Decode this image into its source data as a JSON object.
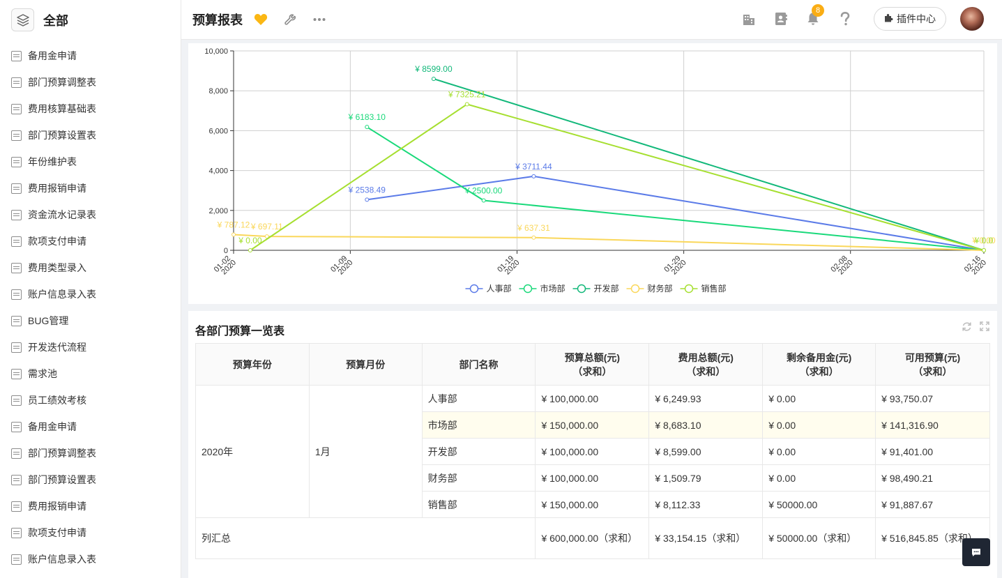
{
  "sidebar": {
    "title": "全部",
    "items": [
      {
        "label": "备用金申请"
      },
      {
        "label": "部门预算调整表"
      },
      {
        "label": "费用核算基础表"
      },
      {
        "label": "部门预算设置表"
      },
      {
        "label": "年份维护表"
      },
      {
        "label": "费用报销申请"
      },
      {
        "label": "资金流水记录表"
      },
      {
        "label": "款项支付申请"
      },
      {
        "label": "费用类型录入"
      },
      {
        "label": "账户信息录入表"
      },
      {
        "label": "BUG管理"
      },
      {
        "label": "开发迭代流程"
      },
      {
        "label": "需求池"
      },
      {
        "label": "员工绩效考核"
      },
      {
        "label": "备用金申请"
      },
      {
        "label": "部门预算调整表"
      },
      {
        "label": "部门预算设置表"
      },
      {
        "label": "费用报销申请"
      },
      {
        "label": "款项支付申请"
      },
      {
        "label": "账户信息录入表"
      }
    ]
  },
  "header": {
    "title": "预算报表",
    "notification_count": "8",
    "plugin_label": "插件中心",
    "icons": [
      "favorite-icon",
      "wrench-icon",
      "more-icon",
      "building-icon",
      "contacts-icon",
      "bell-icon",
      "help-icon",
      "puzzle-icon"
    ]
  },
  "chart_data": {
    "type": "line",
    "y_ticks": [
      "10,000",
      "8,000",
      "6,000",
      "4,000",
      "2,000",
      "0"
    ],
    "ylim": [
      0,
      10000
    ],
    "x_ticks": [
      {
        "date": "01-02",
        "year": "2020"
      },
      {
        "date": "01-09",
        "year": "2020"
      },
      {
        "date": "01-19",
        "year": "2020"
      },
      {
        "date": "01-29",
        "year": "2020"
      },
      {
        "date": "02-08",
        "year": "2020"
      },
      {
        "date": "02-16",
        "year": "2020"
      }
    ],
    "xlim": [
      "2020-01-02",
      "2020-02-16"
    ],
    "grid": true,
    "legend_position": "bottom-center",
    "series": [
      {
        "name": "人事部",
        "color": "#5b7be8",
        "points": [
          [
            "2020-01-10",
            2538.49
          ],
          [
            "2020-01-20",
            3711.44
          ],
          [
            "2020-02-16",
            0
          ]
        ],
        "labels": [
          "¥ 2538.49",
          "¥ 3711.44",
          ""
        ]
      },
      {
        "name": "市场部",
        "color": "#19d97a",
        "points": [
          [
            "2020-01-10",
            6183.1
          ],
          [
            "2020-01-17",
            2500.0
          ],
          [
            "2020-02-16",
            0
          ]
        ],
        "labels": [
          "¥ 6183.10",
          "¥ 2500.00",
          ""
        ]
      },
      {
        "name": "开发部",
        "color": "#12b87a",
        "points": [
          [
            "2020-01-14",
            8599.0
          ],
          [
            "2020-02-16",
            0
          ]
        ],
        "labels": [
          "¥ 8599.00",
          ""
        ]
      },
      {
        "name": "财务部",
        "color": "#fad75a",
        "points": [
          [
            "2020-01-02",
            787.12
          ],
          [
            "2020-01-04",
            697.11
          ],
          [
            "2020-01-20",
            637.31
          ],
          [
            "2020-02-16",
            0
          ]
        ],
        "labels": [
          "¥ 787.12",
          "¥ 697.11",
          "¥ 637.31",
          "¥ 0.00"
        ]
      },
      {
        "name": "销售部",
        "color": "#a6df30",
        "points": [
          [
            "2020-01-03",
            0
          ],
          [
            "2020-01-16",
            7325.21
          ],
          [
            "2020-02-16",
            0
          ]
        ],
        "labels": [
          "¥ 0.00",
          "¥ 7325.21",
          "¥ 0.0"
        ]
      }
    ]
  },
  "table": {
    "title": "各部门预算一览表",
    "headers": [
      {
        "line1": "预算年份",
        "line2": ""
      },
      {
        "line1": "预算月份",
        "line2": ""
      },
      {
        "line1": "部门名称",
        "line2": ""
      },
      {
        "line1": "预算总额(元)",
        "line2": "（求和）"
      },
      {
        "line1": "费用总额(元)",
        "line2": "（求和）"
      },
      {
        "line1": "剩余备用金(元)",
        "line2": "（求和）"
      },
      {
        "line1": "可用预算(元)",
        "line2": "（求和）"
      }
    ],
    "year": "2020年",
    "month": "1月",
    "rows": [
      {
        "dept": "人事部",
        "budget": "¥ 100,000.00",
        "expense": "¥ 6,249.93",
        "reserve": "¥ 0.00",
        "available": "¥ 93,750.07"
      },
      {
        "dept": "市场部",
        "budget": "¥ 150,000.00",
        "expense": "¥ 8,683.10",
        "reserve": "¥ 0.00",
        "available": "¥ 141,316.90"
      },
      {
        "dept": "开发部",
        "budget": "¥ 100,000.00",
        "expense": "¥ 8,599.00",
        "reserve": "¥ 0.00",
        "available": "¥ 91,401.00"
      },
      {
        "dept": "财务部",
        "budget": "¥ 100,000.00",
        "expense": "¥ 1,509.79",
        "reserve": "¥ 0.00",
        "available": "¥ 98,490.21"
      },
      {
        "dept": "销售部",
        "budget": "¥ 150,000.00",
        "expense": "¥ 8,112.33",
        "reserve": "¥ 50000.00",
        "available": "¥ 91,887.67"
      }
    ],
    "total": {
      "label": "列汇总",
      "budget": "¥ 600,000.00（求和）",
      "expense": "¥ 33,154.15（求和）",
      "reserve": "¥ 50000.00（求和）",
      "available": "¥ 516,845.85（求和）"
    }
  }
}
